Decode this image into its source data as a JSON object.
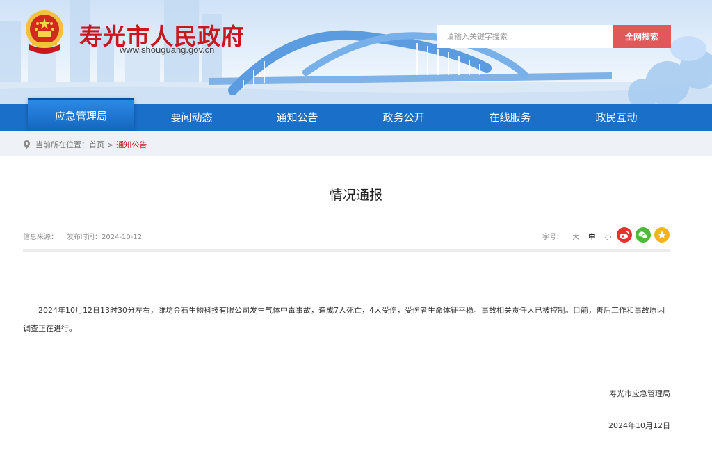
{
  "header": {
    "site_title": "寿光市人民政府",
    "site_url": "www.shouguang.gov.cn",
    "search_placeholder": "请输入关键字搜索",
    "search_button": "全网搜索"
  },
  "nav": {
    "items": [
      {
        "label": "应急管理局",
        "active": true
      },
      {
        "label": "要闻动态",
        "active": false
      },
      {
        "label": "通知公告",
        "active": false
      },
      {
        "label": "政务公开",
        "active": false
      },
      {
        "label": "在线服务",
        "active": false
      },
      {
        "label": "政民互动",
        "active": false
      }
    ]
  },
  "breadcrumb": {
    "prefix": "当前所在位置：",
    "home": "首页",
    "separator": ">",
    "current": "通知公告"
  },
  "article": {
    "title": "情况通报",
    "source_label": "信息来源：",
    "date_label": "发布时间：2024-10-12",
    "fontsize_label": "字号：",
    "fontsize_large": "大",
    "fontsize_medium": "中",
    "fontsize_small": "小",
    "body": "2024年10月12日13时30分左右，潍坊金石生物科技有限公司发生气体中毒事故，造成7人死亡，4人受伤，受伤者生命体征平稳。事故相关责任人已被控制。目前，善后工作和事故原因调查正在进行。",
    "signature": "寿光市应急管理局",
    "sign_date": "2024年10月12日"
  },
  "share": {
    "icons": [
      "weibo-icon",
      "wechat-icon",
      "favorite-star-icon"
    ]
  },
  "colors": {
    "brand_red": "#c8171e",
    "nav_blue": "#1a6fc9",
    "search_button": "#e0595a"
  }
}
